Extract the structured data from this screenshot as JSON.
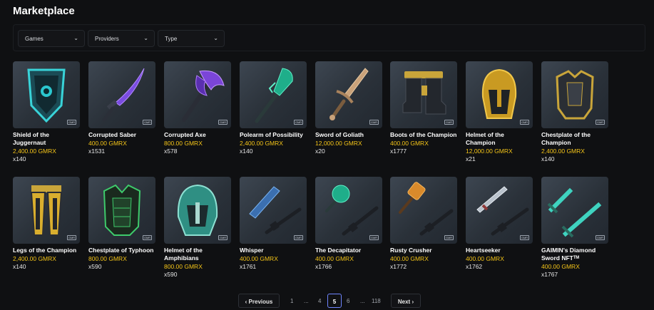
{
  "page": {
    "title": "Marketplace"
  },
  "filters": {
    "games": "Games",
    "providers": "Providers",
    "type": "Type"
  },
  "items": [
    {
      "name": "Shield of the Juggernaut",
      "price": "2,400.00 GMRX",
      "count": "x140",
      "icon": "shield-icon"
    },
    {
      "name": "Corrupted Saber",
      "price": "400.00 GMRX",
      "count": "x1531",
      "icon": "saber-icon"
    },
    {
      "name": "Corrupted Axe",
      "price": "800.00 GMRX",
      "count": "x578",
      "icon": "axe-icon"
    },
    {
      "name": "Polearm of Possibility",
      "price": "2,400.00 GMRX",
      "count": "x140",
      "icon": "polearm-icon"
    },
    {
      "name": "Sword of Goliath",
      "price": "12,000.00 GMRX",
      "count": "x20",
      "icon": "sword-icon"
    },
    {
      "name": "Boots of the Champion",
      "price": "400.00 GMRX",
      "count": "x1777",
      "icon": "boots-icon"
    },
    {
      "name": "Helmet of the Champion",
      "price": "12,000.00 GMRX",
      "count": "x21",
      "icon": "helmet-icon"
    },
    {
      "name": "Chestplate of the Champion",
      "price": "2,400.00 GMRX",
      "count": "x140",
      "icon": "chestplate-icon"
    },
    {
      "name": "Legs of the Champion",
      "price": "2,400.00 GMRX",
      "count": "x140",
      "icon": "legs-icon"
    },
    {
      "name": "Chestplate of Typhoon",
      "price": "800.00 GMRX",
      "count": "x590",
      "icon": "chestplate-icon"
    },
    {
      "name": "Helmet of the Amphibians",
      "price": "800.00 GMRX",
      "count": "x590",
      "icon": "helmet-icon"
    },
    {
      "name": "Whisper",
      "price": "400.00 GMRX",
      "count": "x1761",
      "icon": "gun-icon"
    },
    {
      "name": "The Decapitator",
      "price": "400.00 GMRX",
      "count": "x1766",
      "icon": "gun-icon"
    },
    {
      "name": "Rusty Crusher",
      "price": "400.00 GMRX",
      "count": "x1772",
      "icon": "gun-icon"
    },
    {
      "name": "Heartseeker",
      "price": "400.00 GMRX",
      "count": "x1762",
      "icon": "gun-icon"
    },
    {
      "name": "GAIMIN's Diamond Sword NFTᵀᴹ",
      "price": "400.00 GMRX",
      "count": "x1767",
      "icon": "sword-icon"
    }
  ],
  "pagination": {
    "previous": "Previous",
    "next": "Next",
    "p1": "1",
    "e1": "...",
    "p4": "4",
    "current": "5",
    "p6": "6",
    "e2": "...",
    "last": "118"
  },
  "colors": {
    "price": "#f5c518",
    "accent": "#6f85ff",
    "background": "#0f1012"
  }
}
